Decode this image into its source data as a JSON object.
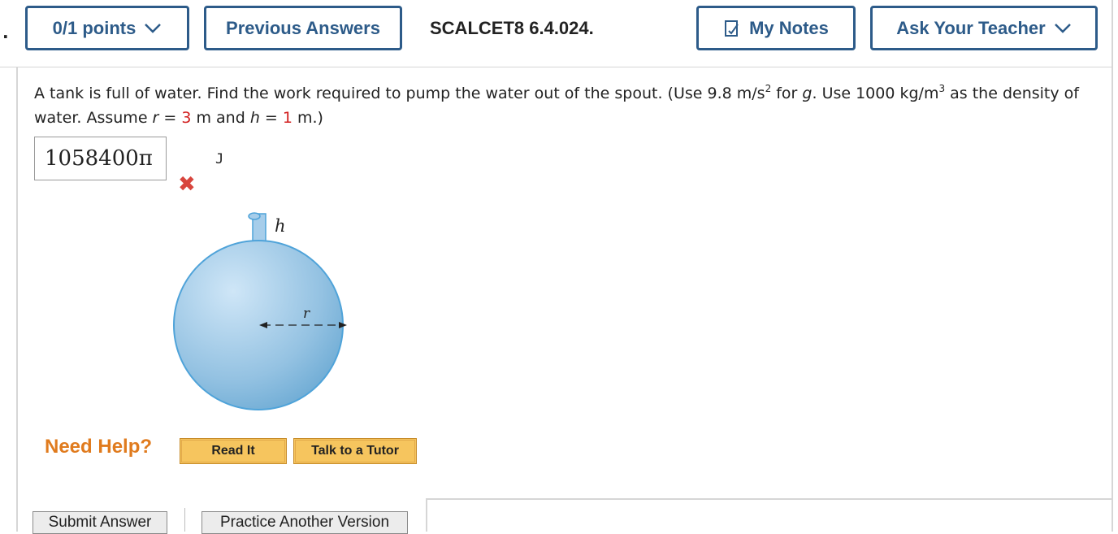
{
  "header": {
    "points_label": "0/1 points",
    "previous_answers_label": "Previous Answers",
    "question_id": "SCALCET8 6.4.024.",
    "my_notes_label": "My Notes",
    "ask_teacher_label": "Ask Your Teacher"
  },
  "question": {
    "part1": "A tank is full of water. Find the work required to pump the water out of the spout. (Use 9.8 m/s",
    "sup1": "2",
    "part2": " for ",
    "g": "g",
    "part3": ". Use 1000 kg/m",
    "sup2": "3",
    "part4": " as the density of water. Assume ",
    "r_var": "r",
    "eq1": " = ",
    "r_val": "3",
    "part5": " m and ",
    "h_var": "h",
    "eq2": " = ",
    "h_val": "1",
    "part6": " m.)"
  },
  "answer": {
    "value": "1058400π",
    "unit": "J",
    "status": "incorrect"
  },
  "figure": {
    "h_label": "h",
    "r_label": "r",
    "colors": {
      "fill": "#8fc0e0",
      "stroke": "#4fa3d9"
    }
  },
  "help": {
    "label": "Need Help?",
    "read_it": "Read It",
    "talk_to_tutor": "Talk to a Tutor"
  },
  "actions": {
    "submit": "Submit Answer",
    "practice": "Practice Another Version"
  },
  "colors": {
    "accent": "#2d5b89",
    "error": "#d8453d",
    "help": "#e07b1e",
    "value_red": "#d21f1f"
  }
}
